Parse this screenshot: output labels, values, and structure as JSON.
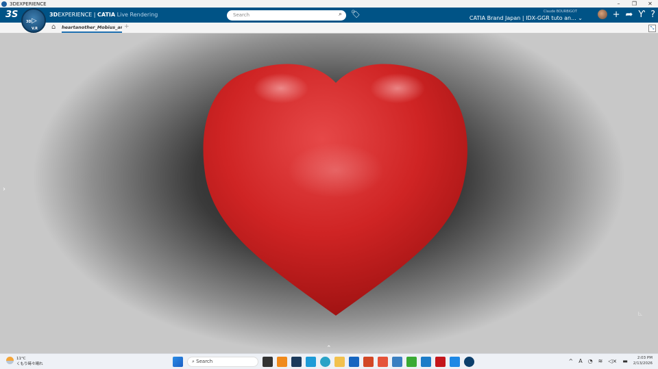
{
  "window": {
    "title": "3DEXPERIENCE",
    "controls": [
      "–",
      "❐",
      "✕"
    ]
  },
  "appbar": {
    "brand_bold": "3D",
    "brand_rest": "EXPERIENCE | ",
    "brand_app": "CATIA",
    "brand_role": "Live Rendering",
    "compass": {
      "top": "V",
      "left": "3D",
      "right": "V",
      "bottom": "V.R"
    },
    "search_placeholder": "Search",
    "user_name": "Claude BOURBIGOT",
    "tenant": "CATIA Brand Japan | IDX-GGR tuto an..."
  },
  "tabs": {
    "items": [
      {
        "label": "heartanother_Mobius_anot"
      }
    ],
    "add": "+"
  },
  "viewport": {
    "object": "heart",
    "object_color": "#d42a2a",
    "background": "#3a3a3a"
  },
  "taskbar": {
    "weather": {
      "temp": "11°C",
      "desc": "くもり時々晴れ"
    },
    "search_placeholder": "Search",
    "tray": {
      "time": "2:03 PM",
      "date": "2/13/2026"
    },
    "apps": [
      {
        "name": "file-explorer",
        "color": "#f2c14e"
      },
      {
        "name": "outlook",
        "color": "#1565c0"
      },
      {
        "name": "powerpoint",
        "color": "#d24726"
      },
      {
        "name": "app-s-red",
        "color": "#e5533a"
      },
      {
        "name": "app-s-blue",
        "color": "#3a7fc1"
      },
      {
        "name": "app-c-green",
        "color": "#3aaa35"
      },
      {
        "name": "app-chart",
        "color": "#1c7cc8"
      },
      {
        "name": "acrobat",
        "color": "#c4161c"
      },
      {
        "name": "app-c-blue",
        "color": "#1e88e5"
      },
      {
        "name": "3dexperience",
        "color": "#0c3f6b"
      }
    ]
  }
}
